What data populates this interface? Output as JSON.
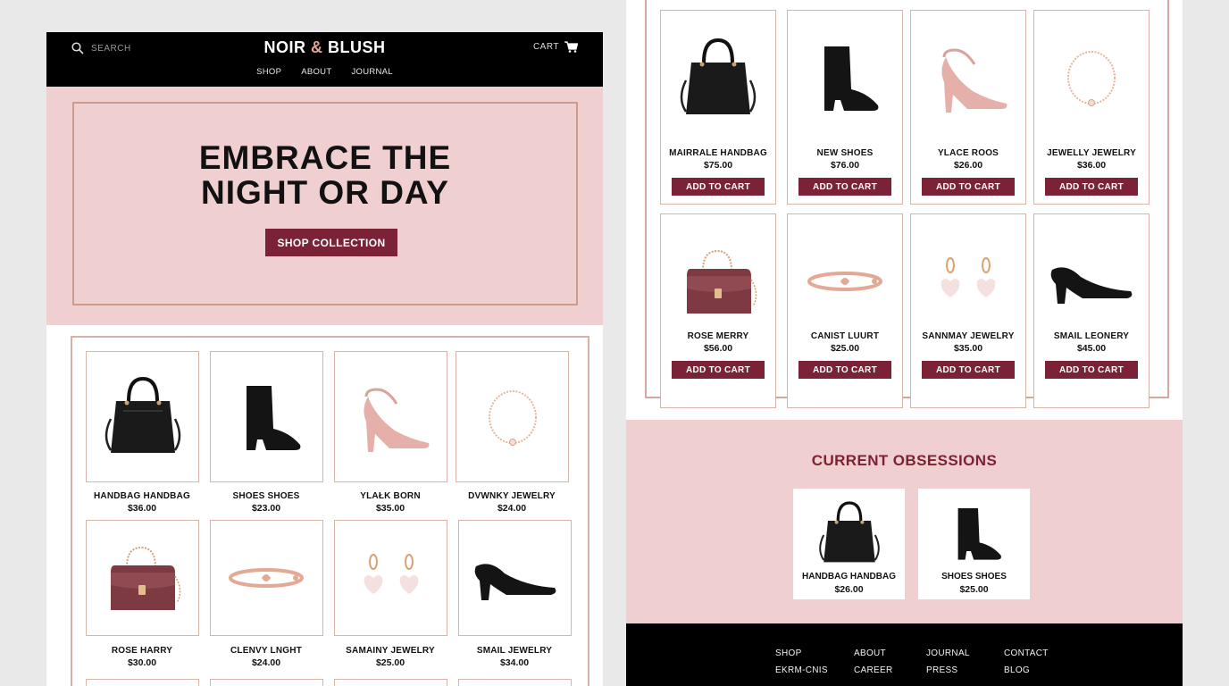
{
  "left_page": {
    "header": {
      "search_label": "SEARCH",
      "logo_part1": "NOIR",
      "logo_amp": "&",
      "logo_part2": "BLUSH",
      "cart_label": "CART",
      "nav": [
        "SHOP",
        "ABOUT",
        "JOURNAL"
      ]
    },
    "hero": {
      "title_line1": "EMBRACE THE",
      "title_line2": "NIGHT OR DAY",
      "cta_label": "SHOP COLLECTION"
    },
    "products": [
      {
        "name": "HANDBAG HANDBAG",
        "price": "$36.00",
        "icon": "black-handbag-icon"
      },
      {
        "name": "SHOES SHOES",
        "price": "$23.00",
        "icon": "black-boot-icon"
      },
      {
        "name": "YLAŁK BORN",
        "price": "$35.00",
        "icon": "pink-pump-icon"
      },
      {
        "name": "DVWNKY JEWELRY",
        "price": "$24.00",
        "icon": "bracelet-icon"
      },
      {
        "name": "ROSE HARRY",
        "price": "$30.00",
        "icon": "burgundy-bag-icon"
      },
      {
        "name": "CLENVY LNGHT",
        "price": "$24.00",
        "icon": "bangle-icon"
      },
      {
        "name": "SAMAINY JEWELRY",
        "price": "$25.00",
        "icon": "heart-earrings-icon"
      },
      {
        "name": "SMAIL JEWELRY",
        "price": "$34.00",
        "icon": "black-pump-icon"
      }
    ]
  },
  "right_page": {
    "add_to_cart_label": "ADD TO CART",
    "products": [
      {
        "name": "MAIRRALE HANDBAG",
        "price": "$75.00",
        "icon": "black-handbag-icon"
      },
      {
        "name": "NEW SHOES",
        "price": "$76.00",
        "icon": "black-boot-icon"
      },
      {
        "name": "YLACE ROOS",
        "price": "$26.00",
        "icon": "pink-pump-icon"
      },
      {
        "name": "JEWELLY JEWELRY",
        "price": "$36.00",
        "icon": "bracelet-icon"
      },
      {
        "name": "ROSE MERRY",
        "price": "$56.00",
        "icon": "burgundy-bag-icon"
      },
      {
        "name": "CANIST LUURT",
        "price": "$25.00",
        "icon": "bangle-icon"
      },
      {
        "name": "SANNMAY JEWELRY",
        "price": "$35.00",
        "icon": "heart-earrings-icon"
      },
      {
        "name": "SMAIL LEONERY",
        "price": "$45.00",
        "icon": "black-pump-icon"
      }
    ],
    "obsessions": {
      "title": "CURRENT OBSESSIONS",
      "items": [
        {
          "name": "HANDBAG HANDBAG",
          "price": "$26.00",
          "icon": "black-handbag-icon"
        },
        {
          "name": "SHOES SHOES",
          "price": "$25.00",
          "icon": "black-boot-icon"
        }
      ]
    },
    "footer": {
      "col1": [
        "SHOP",
        "EKRM-CNIS"
      ],
      "col2": [
        "ABOUT",
        "CAREER"
      ],
      "col3": [
        "JOURNAL",
        "PRESS"
      ],
      "col4": [
        "CONTACT",
        "BLOG"
      ]
    }
  },
  "colors": {
    "accent": "#7c2236",
    "blush": "#efcfcf",
    "rose_gold": "#d4a89c",
    "black": "#000000"
  }
}
